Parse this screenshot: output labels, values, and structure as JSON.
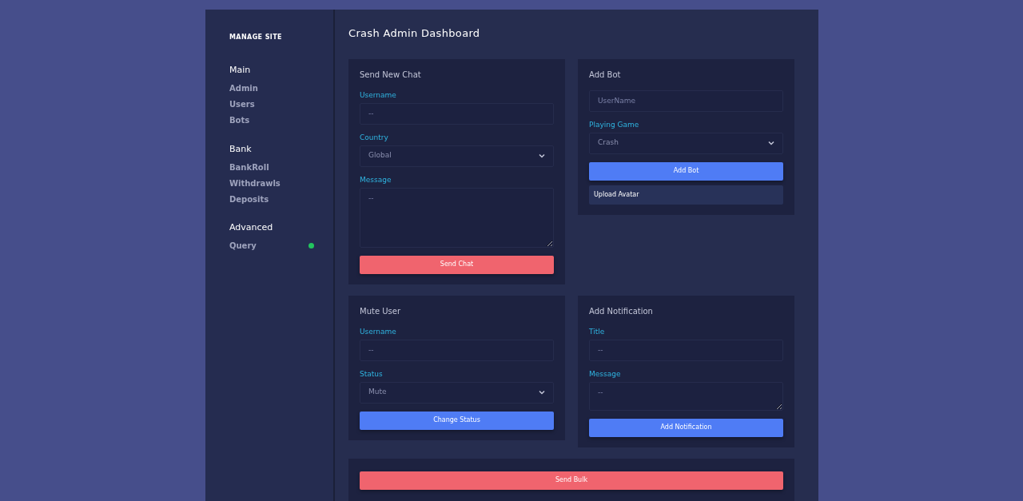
{
  "sidebar": {
    "title": "MANAGE SITE",
    "sections": [
      {
        "heading": "Main",
        "items": [
          {
            "label": "Admin",
            "online": false
          },
          {
            "label": "Users",
            "online": false
          },
          {
            "label": "Bots",
            "online": false
          }
        ]
      },
      {
        "heading": "Bank",
        "items": [
          {
            "label": "BankRoll",
            "online": false
          },
          {
            "label": "Withdrawls",
            "online": false
          },
          {
            "label": "Deposits",
            "online": false
          }
        ]
      },
      {
        "heading": "Advanced",
        "items": [
          {
            "label": "Query",
            "online": true
          }
        ]
      }
    ]
  },
  "page_title": "Crash Admin Dashboard",
  "cards": [
    {
      "title": "Send New Chat",
      "fields": [
        {
          "kind": "input",
          "label": "Username",
          "placeholder": "--"
        },
        {
          "kind": "select",
          "label": "Country",
          "value": "Global"
        },
        {
          "kind": "textarea",
          "label": "Message",
          "placeholder": "--"
        }
      ],
      "buttons": [
        {
          "kind": "danger",
          "label": "Send Chat"
        }
      ]
    },
    {
      "title": "Add Bot",
      "fields": [
        {
          "kind": "input",
          "placeholder": "UserName"
        },
        {
          "kind": "select",
          "label": "Playing Game",
          "value": "Crash"
        }
      ],
      "buttons": [
        {
          "kind": "primary",
          "label": "Add Bot"
        },
        {
          "kind": "secondary",
          "label": "Upload Avatar"
        }
      ]
    },
    {
      "title": "Mute User",
      "fields": [
        {
          "kind": "input",
          "label": "Username",
          "placeholder": "--"
        },
        {
          "kind": "select",
          "label": "Status",
          "value": "Mute"
        }
      ],
      "buttons": [
        {
          "kind": "primary",
          "label": "Change Status"
        }
      ]
    },
    {
      "title": "Add Notification",
      "fields": [
        {
          "kind": "input",
          "label": "Title",
          "placeholder": "--"
        },
        {
          "kind": "textarea",
          "label": "Message",
          "placeholder": "--"
        }
      ],
      "buttons": [
        {
          "kind": "primary",
          "label": "Add Notification"
        }
      ]
    }
  ],
  "bulk_card": {
    "button": {
      "kind": "danger",
      "label": "Send Bulk"
    }
  }
}
